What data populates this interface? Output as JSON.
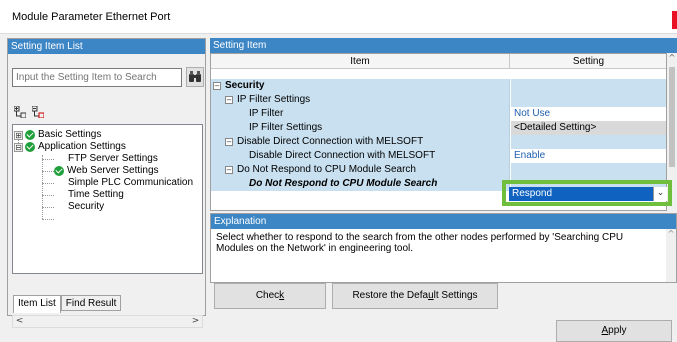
{
  "window": {
    "title": "Module Parameter Ethernet Port"
  },
  "left_panel": {
    "header": "Setting Item List",
    "search_placeholder": "Input the Setting Item to Search",
    "tree": [
      {
        "label": "Basic Settings",
        "expander": "⊞",
        "checked": true
      },
      {
        "label": "Application Settings",
        "expander": "⊟",
        "checked": true
      },
      {
        "label": "FTP Server Settings"
      },
      {
        "label": "Web Server Settings",
        "checked": true
      },
      {
        "label": "Simple PLC Communication"
      },
      {
        "label": "Time Setting"
      },
      {
        "label": "Security"
      }
    ],
    "tabs": [
      "Item List",
      "Find Result"
    ]
  },
  "right_panel": {
    "header": "Setting Item",
    "columns": {
      "item": "Item",
      "setting": "Setting"
    },
    "rows": [
      {
        "item": "Security",
        "setting": ""
      },
      {
        "item": "IP Filter Settings",
        "setting": ""
      },
      {
        "item": "IP Filter",
        "setting": "Not Use"
      },
      {
        "item": "IP Filter Settings",
        "setting": "<Detailed Setting>"
      },
      {
        "item": "Disable Direct Connection with MELSOFT",
        "setting": ""
      },
      {
        "item": "Disable Direct Connection with MELSOFT",
        "setting": "Enable"
      },
      {
        "item": "Do Not Respond to CPU Module Search",
        "setting": ""
      },
      {
        "item": "Do Not Respond to CPU Module Search",
        "setting": "Respond"
      }
    ],
    "explanation_header": "Explanation",
    "explanation_text": "Select whether to respond to the search from the other nodes performed by 'Searching CPU Modules on the Network' in engineering tool."
  },
  "buttons": {
    "check": {
      "pre": "Chec",
      "ul": "k",
      "post": ""
    },
    "restore": {
      "pre": "Restore the Defa",
      "ul": "u",
      "post": "lt Settings"
    },
    "apply": {
      "pre": "",
      "ul": "A",
      "post": "pply"
    }
  },
  "colors": {
    "header_blue": "#3d86c6",
    "highlight_green": "#6fbf3c",
    "selection_blue": "#0f62c0",
    "row_blue": "#c8e0f0"
  }
}
